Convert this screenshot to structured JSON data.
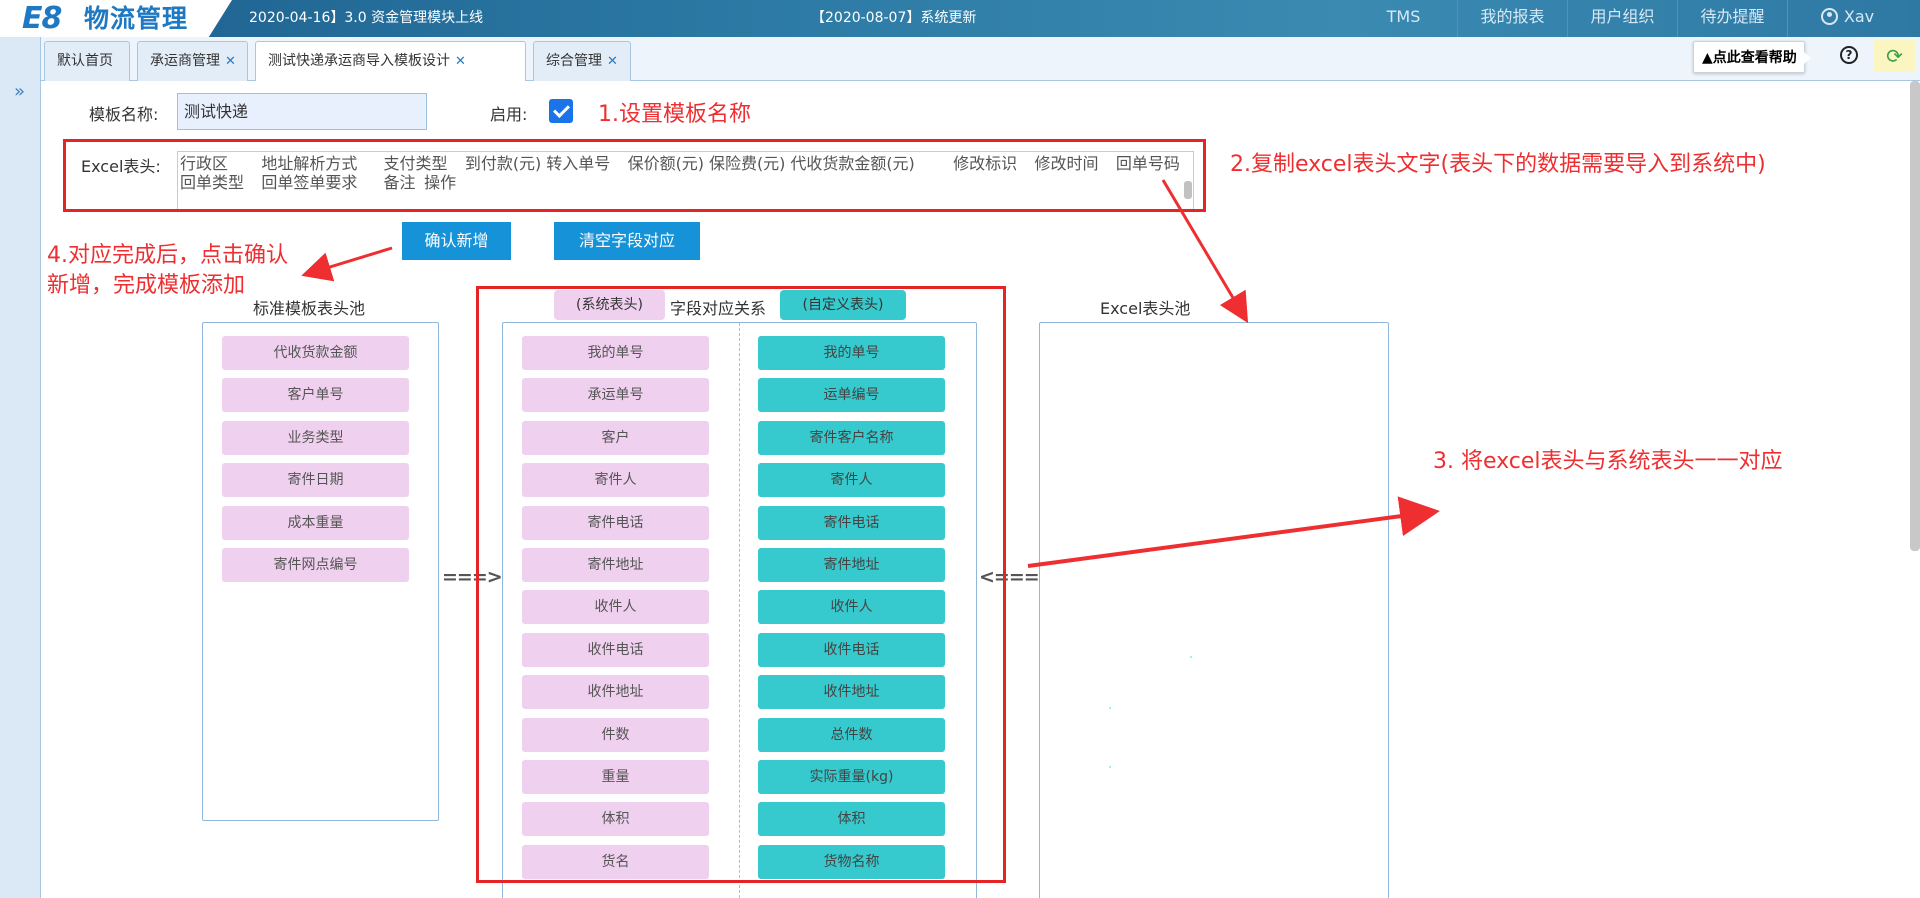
{
  "topbar": {
    "logo_e8": "E8",
    "logo_text": "物流管理",
    "notice1": "2020-04-16】3.0 资金管理模块上线",
    "notice2": "【2020-08-07】系统更新",
    "nav": [
      "TMS",
      "我的报表",
      "用户组织",
      "待办提醒"
    ],
    "user": "Xav"
  },
  "tabs": [
    {
      "label": "默认首页",
      "closable": false
    },
    {
      "label": "承运商管理",
      "closable": true
    },
    {
      "label": "测试快递承运商导入模板设计",
      "closable": true,
      "active": true
    },
    {
      "label": "综合管理",
      "closable": true
    }
  ],
  "toolbar": {
    "help_label": "点此查看帮助",
    "question_icon": "?",
    "skin_icon": "skin-icon"
  },
  "form": {
    "name_label": "模板名称:",
    "name_value": "测试快递",
    "enable_label": "启用:",
    "enabled": true,
    "excel_label": "Excel表头:",
    "excel_value": "行政区\t地址解析方式\t支付类型\t到付款(元)\t转入单号\t保价额(元)\t保险费(元)\t代收货款金额(元)\t修改标识\t修改时间\t回单号码\t回单类型\t回单签单要求\t备注\t操作"
  },
  "buttons": {
    "confirm": "确认新增",
    "clear": "清空字段对应"
  },
  "pools": {
    "standard_title": "标准模板表头池",
    "mapping_title": "字段对应关系",
    "system_header": "(系统表头)",
    "custom_header": "(自定义表头)",
    "excel_title": "Excel表头池",
    "arrow_right": "===>",
    "arrow_left": "<===",
    "standard_items": [
      "代收货款金额",
      "客户单号",
      "业务类型",
      "寄件日期",
      "成本重量",
      "寄件网点编号"
    ],
    "system_items": [
      "我的单号",
      "承运单号",
      "客户",
      "寄件人",
      "寄件电话",
      "寄件地址",
      "收件人",
      "收件电话",
      "收件地址",
      "件数",
      "重量",
      "体积",
      "货名"
    ],
    "custom_items": [
      "我的单号",
      "运单编号",
      "寄件客户名称",
      "寄件人",
      "寄件电话",
      "寄件地址",
      "收件人",
      "收件电话",
      "收件地址",
      "总件数",
      "实际重量(kg)",
      "体积",
      "货物名称"
    ]
  },
  "annotations": {
    "step1": "1.设置模板名称",
    "step2": "2.复制excel表头文字(表头下的数据需要导入到系统中)",
    "step3": "3. 将excel表头与系统表头一一对应",
    "step4_line1": "4.对应完成后，点击确认",
    "step4_line2": "新增，完成模板添加"
  },
  "colors": {
    "accent": "#1592d8",
    "system_pill": "#efd0ee",
    "custom_pill": "#36c9cd",
    "annotation": "#ee2e30"
  }
}
